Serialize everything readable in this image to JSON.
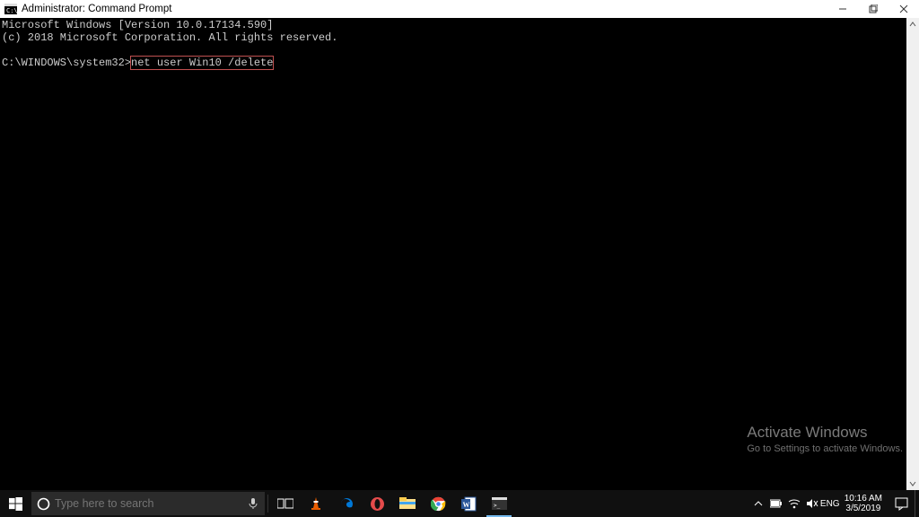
{
  "window": {
    "title": "Administrator: Command Prompt"
  },
  "console": {
    "version_line": "Microsoft Windows [Version 10.0.17134.590]",
    "copyright_line": "(c) 2018 Microsoft Corporation. All rights reserved.",
    "prompt": "C:\\WINDOWS\\system32>",
    "command": "net user Win10 /delete"
  },
  "activate": {
    "title": "Activate Windows",
    "sub": "Go to Settings to activate Windows."
  },
  "search": {
    "placeholder": "Type here to search",
    "value": ""
  },
  "tray": {
    "lang": "ENG",
    "time": "10:16 AM",
    "date": "3/5/2019"
  },
  "icons": {
    "cmd": "cmd-icon",
    "minimize": "minimize-icon",
    "maximize": "maximize-icon",
    "close": "close-icon",
    "scroll_up": "chevron-up-icon",
    "scroll_down": "chevron-down-icon",
    "start": "windows-start-icon",
    "cortana": "cortana-circle-icon",
    "mic": "mic-icon",
    "taskview": "task-view-icon",
    "vlc": "vlc-icon",
    "edge": "edge-icon",
    "opera": "opera-icon",
    "explorer": "file-explorer-icon",
    "chrome": "chrome-icon",
    "word": "word-icon",
    "terminal": "terminal-icon",
    "tray_chevron": "chevron-up-icon",
    "power": "power-icon",
    "wifi": "wifi-icon",
    "volume": "volume-muted-icon",
    "notif": "notification-icon"
  },
  "colors": {
    "edge": "#0078d7",
    "opera": "#e44b4b",
    "vlc": "#e85d00",
    "chrome_y": "#fbbc05",
    "chrome_g": "#34a853",
    "chrome_r": "#ea4335",
    "chrome_b": "#4285f4",
    "word": "#2b579a"
  }
}
